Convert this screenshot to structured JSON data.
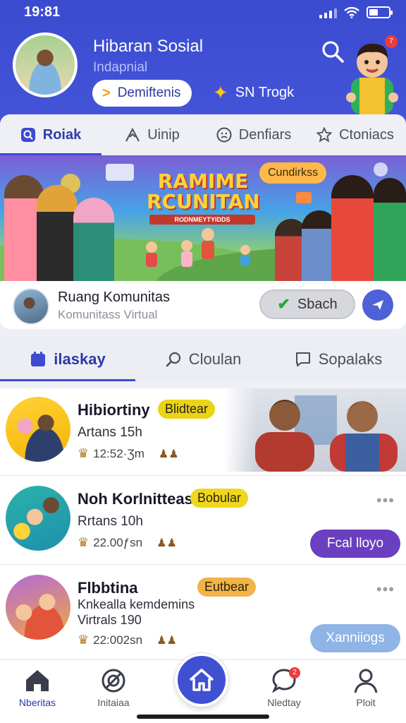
{
  "status_bar": {
    "time": "19:81"
  },
  "header": {
    "app_title": "Hibaran Sosial",
    "app_subtitle": "Indapnial",
    "pill_button_label": "Demiftenis",
    "trending_label": "SN Trogk",
    "notification_count": "7"
  },
  "top_tabs": [
    {
      "label": "Roiak",
      "icon": "search-square-icon",
      "active": true
    },
    {
      "label": "Uinip",
      "icon": "mountain-icon",
      "active": false
    },
    {
      "label": "Denfiars",
      "icon": "smiley-icon",
      "active": false
    },
    {
      "label": "Ctoniacs",
      "icon": "star-outline-icon",
      "active": false
    }
  ],
  "banner": {
    "title": "RAMIME RCUNITAN",
    "subtitle": "RODNMEYTYIDDS",
    "badge": "Cundirkss"
  },
  "community": {
    "name": "Ruang Komunitas",
    "subtitle": "Komunitass Virtual",
    "join_label": "Sbach"
  },
  "section_tabs": [
    {
      "label": "ilaskay",
      "icon": "calendar-icon",
      "active": true
    },
    {
      "label": "Cloulan",
      "icon": "magnifier-icon",
      "active": false
    },
    {
      "label": "Sopalaks",
      "icon": "chat-square-icon",
      "active": false
    }
  ],
  "feed": [
    {
      "name": "Hibiortiny",
      "badge": "Blidtear",
      "badge_color": "#e9d416",
      "meta": "Artans 15h",
      "stats": "12:52·Ʒm"
    },
    {
      "name": "Noh Korlnitteas",
      "badge": "Bobular",
      "badge_color": "#f0d71e",
      "meta": "Rrtans 10h",
      "stats": "22.00ƒsn",
      "action_label": "Fcal lloyo",
      "action_color": "#6a3fc0"
    },
    {
      "name": "Flbbtina",
      "badge": "Eutbear",
      "badge_color": "#f2b347",
      "line1": "Knkealla kemdemins",
      "line2": "Virtrals 190",
      "stats": "22:002sn",
      "action_label": "Xanniiogs",
      "action_color": "#8fb4e6"
    }
  ],
  "bottom_nav": [
    {
      "label": "Nberitas",
      "icon": "house-icon",
      "active": true
    },
    {
      "label": "Initaiaa",
      "icon": "target-icon",
      "active": false
    },
    {
      "label": "Nledtay",
      "icon": "chat-bubble-icon",
      "active": false,
      "badge": "2"
    },
    {
      "label": "Ploit",
      "icon": "person-icon",
      "active": false
    }
  ]
}
